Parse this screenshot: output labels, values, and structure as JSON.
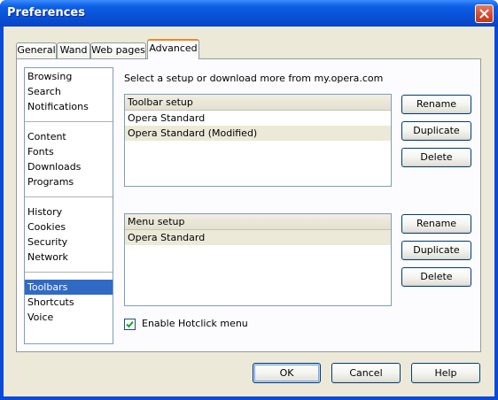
{
  "window": {
    "title": "Preferences"
  },
  "tabs": [
    {
      "label": "General",
      "active": false
    },
    {
      "label": "Wand",
      "active": false
    },
    {
      "label": "Web pages",
      "active": false
    },
    {
      "label": "Advanced",
      "active": true
    }
  ],
  "categories": {
    "group1": [
      "Browsing",
      "Search",
      "Notifications"
    ],
    "group2": [
      "Content",
      "Fonts",
      "Downloads",
      "Programs"
    ],
    "group3": [
      "History",
      "Cookies",
      "Security",
      "Network"
    ],
    "group4": [
      "Toolbars",
      "Shortcuts",
      "Voice"
    ],
    "selected": "Toolbars"
  },
  "instruction": "Select a setup or download more from my.opera.com",
  "toolbar_setup": {
    "header": "Toolbar setup",
    "rows": [
      "Opera Standard",
      "Opera Standard (Modified)"
    ],
    "selected_row": 1,
    "buttons": {
      "rename": "Rename",
      "duplicate": "Duplicate",
      "delete": "Delete"
    }
  },
  "menu_setup": {
    "header": "Menu setup",
    "rows": [
      "Opera Standard"
    ],
    "selected_row": 0,
    "buttons": {
      "rename": "Rename",
      "duplicate": "Duplicate",
      "delete": "Delete"
    }
  },
  "hotclick": {
    "label": "Enable Hotclick menu",
    "checked": true
  },
  "dialog_buttons": {
    "ok": "OK",
    "cancel": "Cancel",
    "help": "Help"
  },
  "colors": {
    "title_bar": "#0a52d8",
    "selection": "#316ac5",
    "active_tab_accent": "#e68b2c",
    "close_button": "#d4482a"
  }
}
